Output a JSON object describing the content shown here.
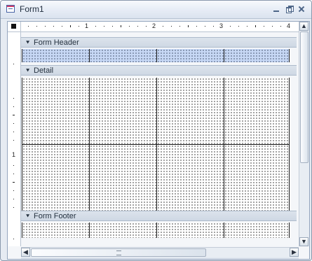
{
  "window": {
    "title": "Form1",
    "buttons": {
      "minimize_icon": "minimize-icon",
      "restore_icon": "restore-icon",
      "close_icon": "close-icon"
    }
  },
  "designer": {
    "top_ruler": {
      "labels": [
        "1",
        "2",
        "3",
        "4"
      ]
    },
    "left_ruler": {
      "labels": [
        "1"
      ]
    },
    "sections": {
      "header": {
        "label": "Form Header",
        "icon": "chevron-down-icon"
      },
      "detail": {
        "label": "Detail",
        "icon": "chevron-down-icon"
      },
      "footer": {
        "label": "Form Footer",
        "icon": "chevron-down-icon"
      }
    },
    "scrollbars": {
      "horizontal": {
        "left_icon": "scroll-left-icon",
        "right_icon": "scroll-right-icon",
        "thumb_icon": "scroll-thumb"
      },
      "vertical": {
        "up_icon": "scroll-up-icon",
        "down_icon": "scroll-down-icon",
        "thumb_icon": "scroll-thumb"
      }
    }
  },
  "colors": {
    "header_grid": "#c7d8f5",
    "window_border": "#8a99ad",
    "section_bar": "#d5dde8"
  }
}
